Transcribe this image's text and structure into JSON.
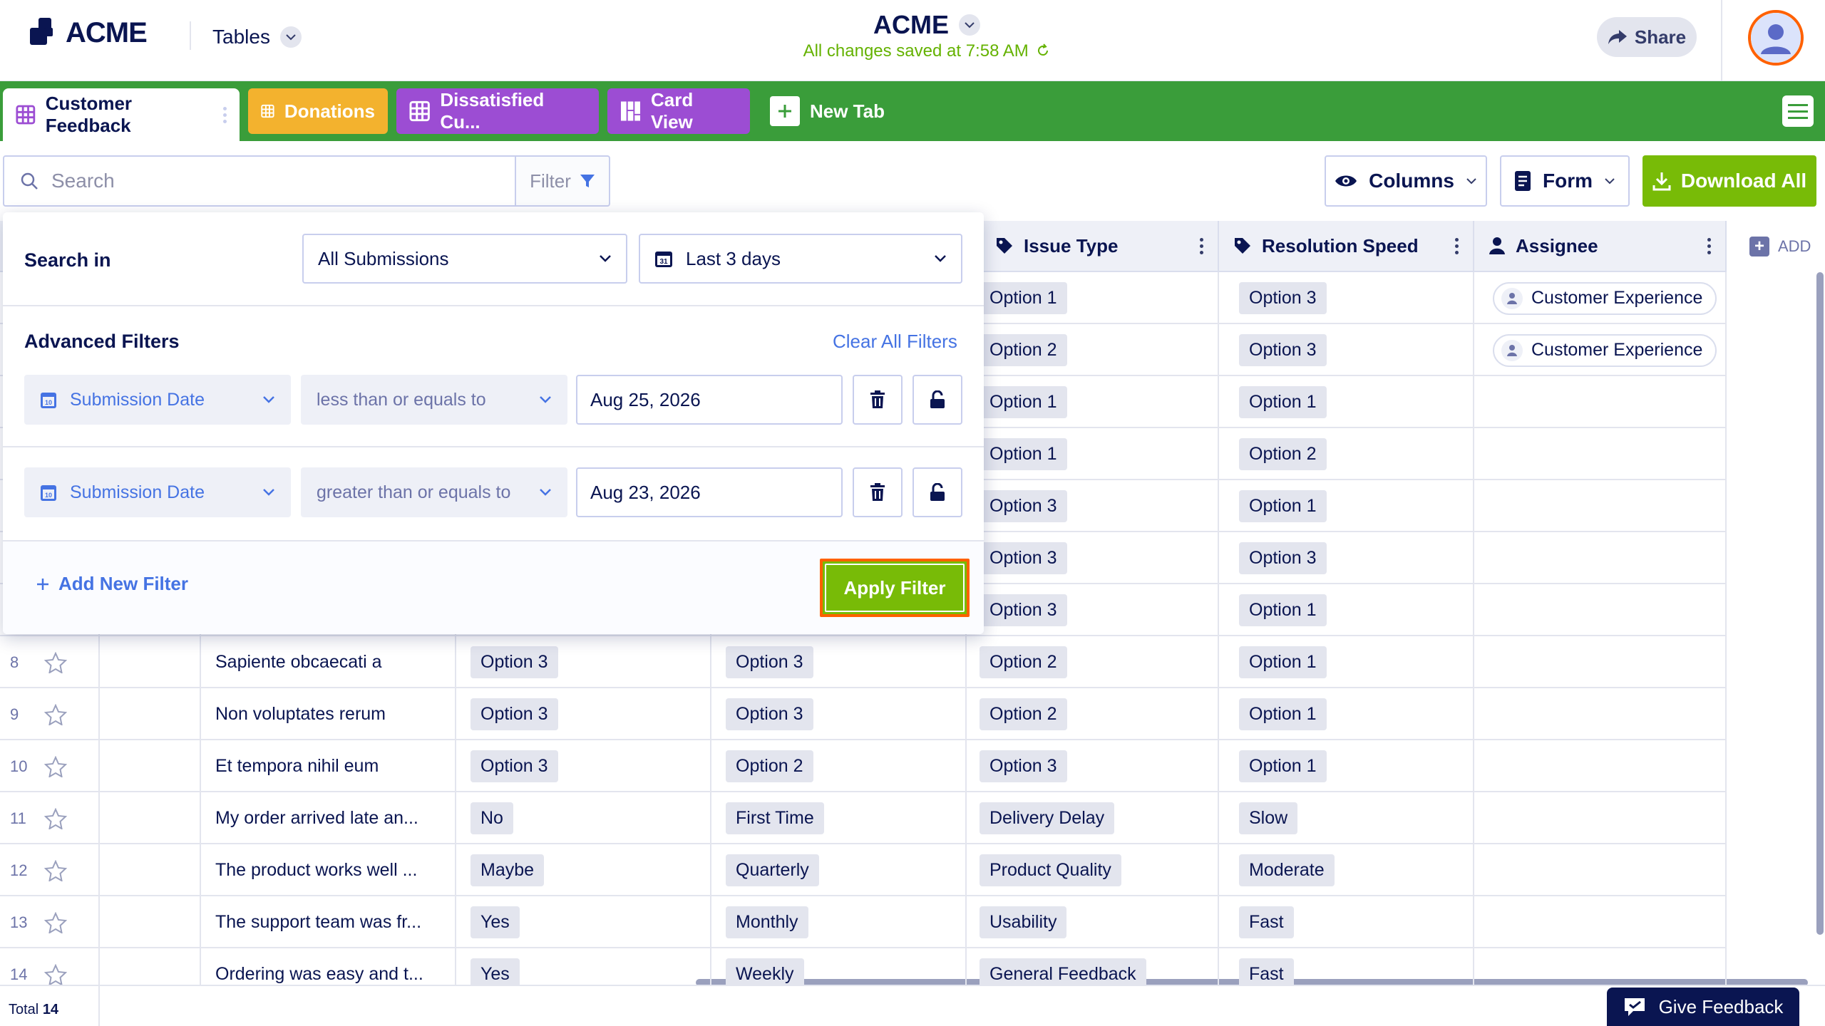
{
  "header": {
    "logo_text": "ACME",
    "nav_label": "Tables",
    "app_title": "ACME",
    "saved_status": "All changes saved at 7:58 AM",
    "share_label": "Share"
  },
  "tabs": [
    {
      "label": "Customer Feedback",
      "color": "#ffffff",
      "active": true
    },
    {
      "label": "Donations",
      "color": "#f3b22e"
    },
    {
      "label": "Dissatisfied Cu...",
      "color": "#9c4dd3"
    },
    {
      "label": "Card View",
      "color": "#9c4dd3"
    },
    {
      "label": "New Tab",
      "color": "#3a9d3a"
    }
  ],
  "toolbar": {
    "search_placeholder": "Search",
    "filter_label": "Filter",
    "columns_label": "Columns",
    "form_label": "Form",
    "download_label": "Download All"
  },
  "table": {
    "headers": {
      "issue_type": "Issue Type",
      "resolution_speed": "Resolution Speed",
      "assignee": "Assignee",
      "add": "ADD"
    },
    "rows": [
      {
        "num": "",
        "text": "",
        "c1": "",
        "c2": "",
        "issue": "Option 1",
        "speed": "Option 3",
        "assignee": "Customer Experience"
      },
      {
        "num": "",
        "text": "",
        "c1": "",
        "c2": "",
        "issue": "Option 2",
        "speed": "Option 3",
        "assignee": "Customer Experience"
      },
      {
        "num": "",
        "text": "",
        "c1": "",
        "c2": "",
        "issue": "Option 1",
        "speed": "Option 1",
        "assignee": ""
      },
      {
        "num": "",
        "text": "",
        "c1": "",
        "c2": "",
        "issue": "Option 1",
        "speed": "Option 2",
        "assignee": ""
      },
      {
        "num": "",
        "text": "",
        "c1": "",
        "c2": "",
        "issue": "Option 3",
        "speed": "Option 1",
        "assignee": ""
      },
      {
        "num": "",
        "text": "",
        "c1": "",
        "c2": "",
        "issue": "Option 3",
        "speed": "Option 3",
        "assignee": ""
      },
      {
        "num": "",
        "text": "",
        "c1": "",
        "c2": "",
        "issue": "Option 3",
        "speed": "Option 1",
        "assignee": ""
      },
      {
        "num": "8",
        "text": "Sapiente obcaecati a",
        "c1": "Option 3",
        "c2": "Option 3",
        "issue": "Option 2",
        "speed": "Option 1",
        "assignee": ""
      },
      {
        "num": "9",
        "text": "Non voluptates rerum",
        "c1": "Option 3",
        "c2": "Option 3",
        "issue": "Option 2",
        "speed": "Option 1",
        "assignee": ""
      },
      {
        "num": "10",
        "text": "Et tempora nihil eum",
        "c1": "Option 3",
        "c2": "Option 2",
        "issue": "Option 3",
        "speed": "Option 1",
        "assignee": ""
      },
      {
        "num": "11",
        "text": "My order arrived late an...",
        "c1": "No",
        "c2": "First Time",
        "issue": "Delivery Delay",
        "speed": "Slow",
        "assignee": ""
      },
      {
        "num": "12",
        "text": "The product works well ...",
        "c1": "Maybe",
        "c2": "Quarterly",
        "issue": "Product Quality",
        "speed": "Moderate",
        "assignee": ""
      },
      {
        "num": "13",
        "text": "The support team was fr...",
        "c1": "Yes",
        "c2": "Monthly",
        "issue": "Usability",
        "speed": "Fast",
        "assignee": ""
      },
      {
        "num": "14",
        "text": "Ordering was easy and t...",
        "c1": "Yes",
        "c2": "Weekly",
        "issue": "General Feedback",
        "speed": "Fast",
        "assignee": ""
      }
    ]
  },
  "footer": {
    "total_label": "Total",
    "total_count": "14",
    "feedback_label": "Give Feedback"
  },
  "filter_panel": {
    "search_in_label": "Search in",
    "scope_value": "All Submissions",
    "range_value": "Last 3 days",
    "advanced_label": "Advanced Filters",
    "clear_all_label": "Clear All Filters",
    "filters": [
      {
        "field": "Submission Date",
        "operator": "less than or equals to",
        "value": "Aug 25, 2026"
      },
      {
        "field": "Submission Date",
        "operator": "greater than or equals to",
        "value": "Aug 23, 2026"
      }
    ],
    "add_filter_label": "Add New Filter",
    "apply_label": "Apply Filter"
  },
  "colors": {
    "brand_navy": "#0a1551",
    "tab_bar_green": "#3a9d3a",
    "download_green": "#78bb07",
    "highlight_orange": "#ff6100",
    "link_blue": "#4573e3"
  }
}
